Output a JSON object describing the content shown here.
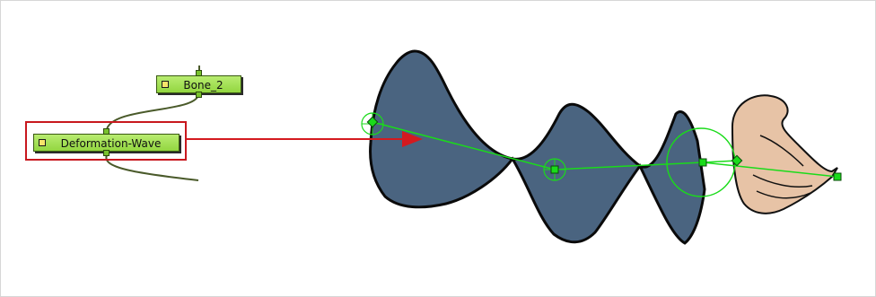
{
  "nodes": {
    "bone": {
      "label": "Bone_2"
    },
    "deformation": {
      "label": "Deformation-Wave"
    }
  },
  "colors": {
    "node_fill": "#a5e05a",
    "callout": "#d41a1f",
    "deformer": "#22dd22",
    "shape": "#4a6480",
    "skin": "#e7c3a6"
  }
}
